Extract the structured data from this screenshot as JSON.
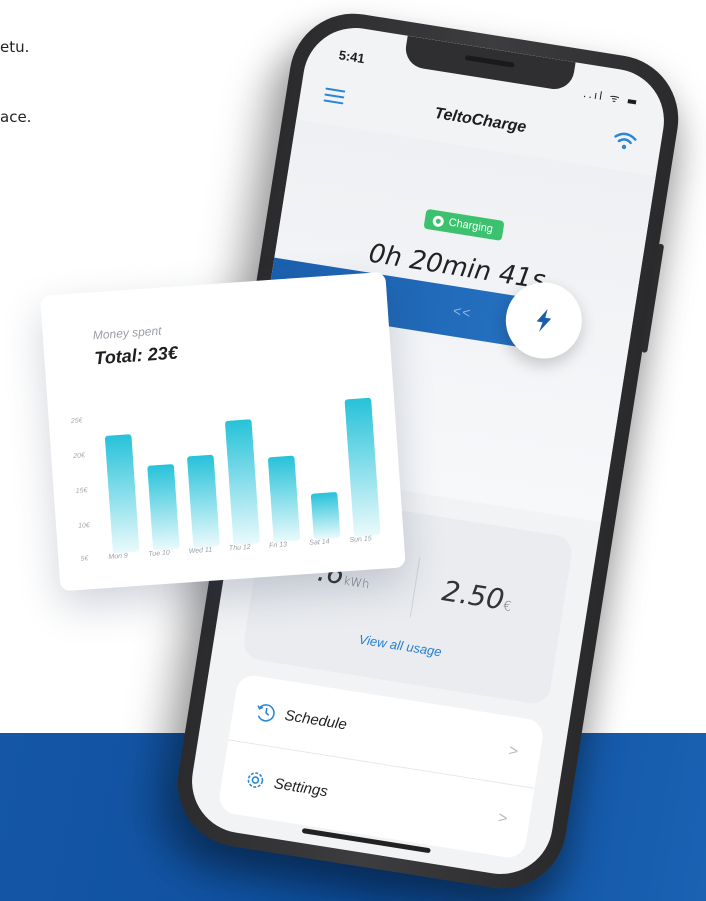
{
  "background_text": {
    "line1": "etu.",
    "line2": "ace."
  },
  "phone": {
    "status_time": "5:41",
    "status_icons": "..ıl ᯤ ▬",
    "app_title": "TeltoCharge",
    "charging_badge": "Charging",
    "timer": "0h 20min 41s",
    "swipe_arrows": "<<",
    "usage": {
      "energy_value": ".6",
      "energy_unit": "kWh",
      "price_value": "2.50",
      "price_unit": "€",
      "view_link": "View all usage"
    },
    "menu": [
      {
        "label": "Schedule",
        "icon": "clock-icon"
      },
      {
        "label": "Settings",
        "icon": "gear-icon"
      }
    ],
    "chevron": ">"
  },
  "stats_card": {
    "subtitle": "Money spent",
    "total": "Total: 23€",
    "y_ticks": [
      "25€",
      "20€",
      "15€",
      "10€",
      "5€"
    ]
  },
  "chart_data": {
    "type": "bar",
    "categories": [
      "Mon 9",
      "Tue 10",
      "Wed 11",
      "Thu 12",
      "Fri 13",
      "Sat 14",
      "Sun 15"
    ],
    "values": [
      23,
      18,
      19,
      24,
      18,
      12,
      26
    ],
    "ylim": [
      5,
      27
    ],
    "colors": {
      "top": "#26c2d9",
      "bottom": "#eafafc"
    }
  },
  "colors": {
    "accent_blue": "#1a5fae",
    "link_blue": "#2a7fd0",
    "charging_green": "#3cc26f",
    "band_blue": "#0d4f9f"
  }
}
